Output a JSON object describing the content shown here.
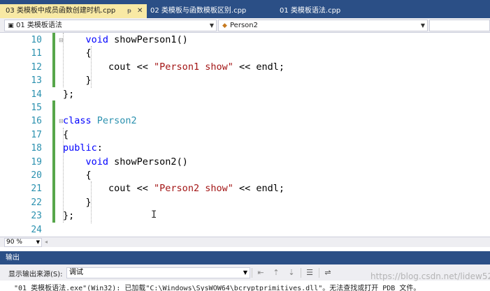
{
  "tabs": [
    {
      "label": "03 类模板中成员函数创建时机.cpp",
      "pin": "ᵽ",
      "close": "✕"
    },
    {
      "label": "02 类模板与函数模板区别.cpp"
    },
    {
      "label": "01 类模板语法.cpp"
    }
  ],
  "nav": {
    "project": "01 类模板语法",
    "scope": "Person2",
    "member": ""
  },
  "icons": {
    "project": "project-icon",
    "class": "class-icon",
    "dropdown": "chevron-down-icon"
  },
  "code_lines": [
    {
      "num": "10",
      "tokens": [
        {
          "t": "    "
        },
        {
          "t": "void",
          "c": "kw"
        },
        {
          "t": " showPerson1()"
        }
      ]
    },
    {
      "num": "11",
      "tokens": [
        {
          "t": "    {"
        }
      ]
    },
    {
      "num": "12",
      "tokens": [
        {
          "t": "        cout << "
        },
        {
          "t": "\"Person1 show\"",
          "c": "st"
        },
        {
          "t": " << endl;"
        }
      ]
    },
    {
      "num": "13",
      "tokens": [
        {
          "t": "    }"
        }
      ]
    },
    {
      "num": "14",
      "tokens": [
        {
          "t": "};"
        }
      ]
    },
    {
      "num": "15",
      "tokens": []
    },
    {
      "num": "16",
      "tokens": [
        {
          "t": "class",
          "c": "kw"
        },
        {
          "t": " "
        },
        {
          "t": "Person2",
          "c": "ty"
        }
      ]
    },
    {
      "num": "17",
      "tokens": [
        {
          "t": "{"
        }
      ]
    },
    {
      "num": "18",
      "tokens": [
        {
          "t": "public",
          "c": "kw"
        },
        {
          "t": ":"
        }
      ]
    },
    {
      "num": "19",
      "tokens": [
        {
          "t": "    "
        },
        {
          "t": "void",
          "c": "kw"
        },
        {
          "t": " showPerson2()"
        }
      ]
    },
    {
      "num": "20",
      "tokens": [
        {
          "t": "    {"
        }
      ]
    },
    {
      "num": "21",
      "tokens": [
        {
          "t": "        cout << "
        },
        {
          "t": "\"Person2 show\"",
          "c": "st"
        },
        {
          "t": " << endl;"
        }
      ]
    },
    {
      "num": "22",
      "tokens": [
        {
          "t": "    }"
        }
      ]
    },
    {
      "num": "23",
      "tokens": [
        {
          "t": "};"
        }
      ]
    },
    {
      "num": "24",
      "tokens": []
    }
  ],
  "zoom": "90 %",
  "output": {
    "title": "输出",
    "source_label": "显示输出来源(S):",
    "source_value": "调试",
    "lines": [
      "\"01 类模板语法.exe\"(Win32): 已加载\"C:\\Windows\\SysWOW64\\bcryptprimitives.dll\"。无法查找或打开 PDB 文件。"
    ]
  },
  "watermark": "https://blog.csdn.net/lidew521",
  "colors": {
    "tab_bar": "#2b4f86",
    "active_tab": "#f8e9a4",
    "keyword": "#0000ff",
    "type": "#2b91af",
    "string": "#a31515",
    "line_number": "#2b91af",
    "change_bar": "#57a64a"
  }
}
